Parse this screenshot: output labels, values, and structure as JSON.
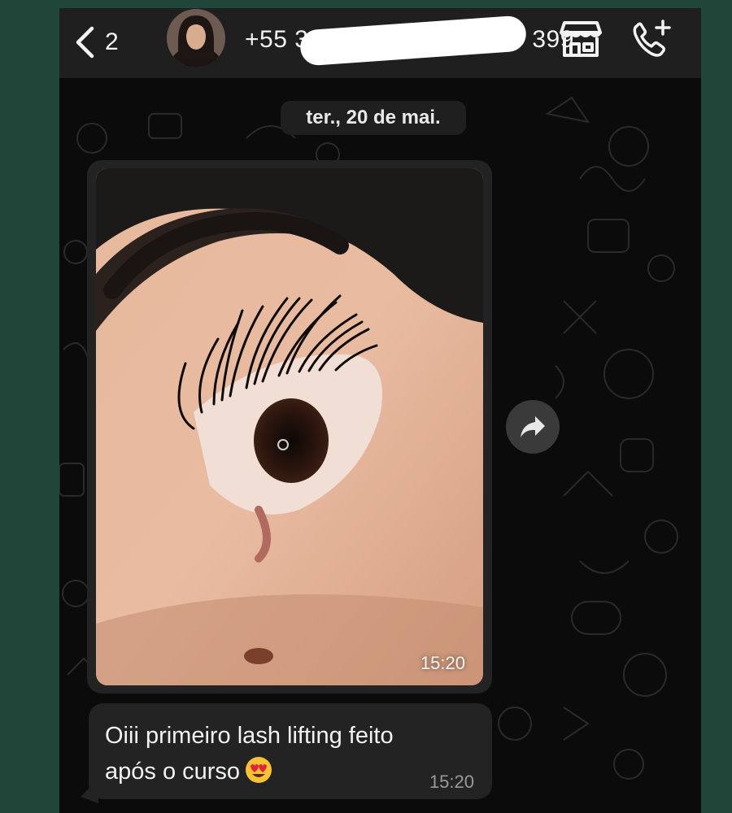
{
  "header": {
    "back_count": "2",
    "contact_name": "+55 3                399",
    "icons": [
      "chevron-left-icon",
      "store-icon",
      "add-call-icon"
    ]
  },
  "chat": {
    "date_label": "ter., 20 de mai.",
    "photo_message": {
      "time": "15:20"
    },
    "text_message": {
      "line1": "Oiii primeiro lash lifting feito",
      "line2": "após o curso",
      "emoji": "heart-eyes-emoji",
      "time": "15:20"
    }
  },
  "colors": {
    "outer_background": "#20463a",
    "chat_background": "#0b0b0b",
    "header": "#1f1f1f",
    "bubble": "#232323",
    "text": "#f2f2f2",
    "time_text": "#9a9a9a"
  }
}
